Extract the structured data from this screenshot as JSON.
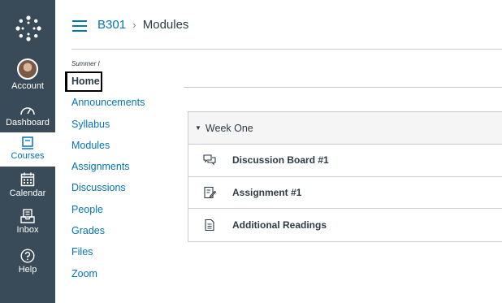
{
  "global_nav": {
    "items": [
      {
        "label": "Account"
      },
      {
        "label": "Dashboard"
      },
      {
        "label": "Courses"
      },
      {
        "label": "Calendar"
      },
      {
        "label": "Inbox"
      },
      {
        "label": "Help"
      }
    ]
  },
  "header": {
    "course": "B301",
    "separator": "›",
    "page": "Modules"
  },
  "course_nav": {
    "term": "Summer I",
    "items": [
      "Home",
      "Announcements",
      "Syllabus",
      "Modules",
      "Assignments",
      "Discussions",
      "People",
      "Grades",
      "Files",
      "Zoom"
    ]
  },
  "module": {
    "title": "Week One",
    "items": [
      {
        "title": "Discussion Board #1",
        "icon": "discussion-icon"
      },
      {
        "title": "Assignment #1",
        "icon": "assignment-icon"
      },
      {
        "title": "Additional Readings",
        "icon": "page-icon"
      }
    ]
  },
  "colors": {
    "nav_bg": "#394b58",
    "link": "#0374b5",
    "text": "#2d3b45"
  }
}
